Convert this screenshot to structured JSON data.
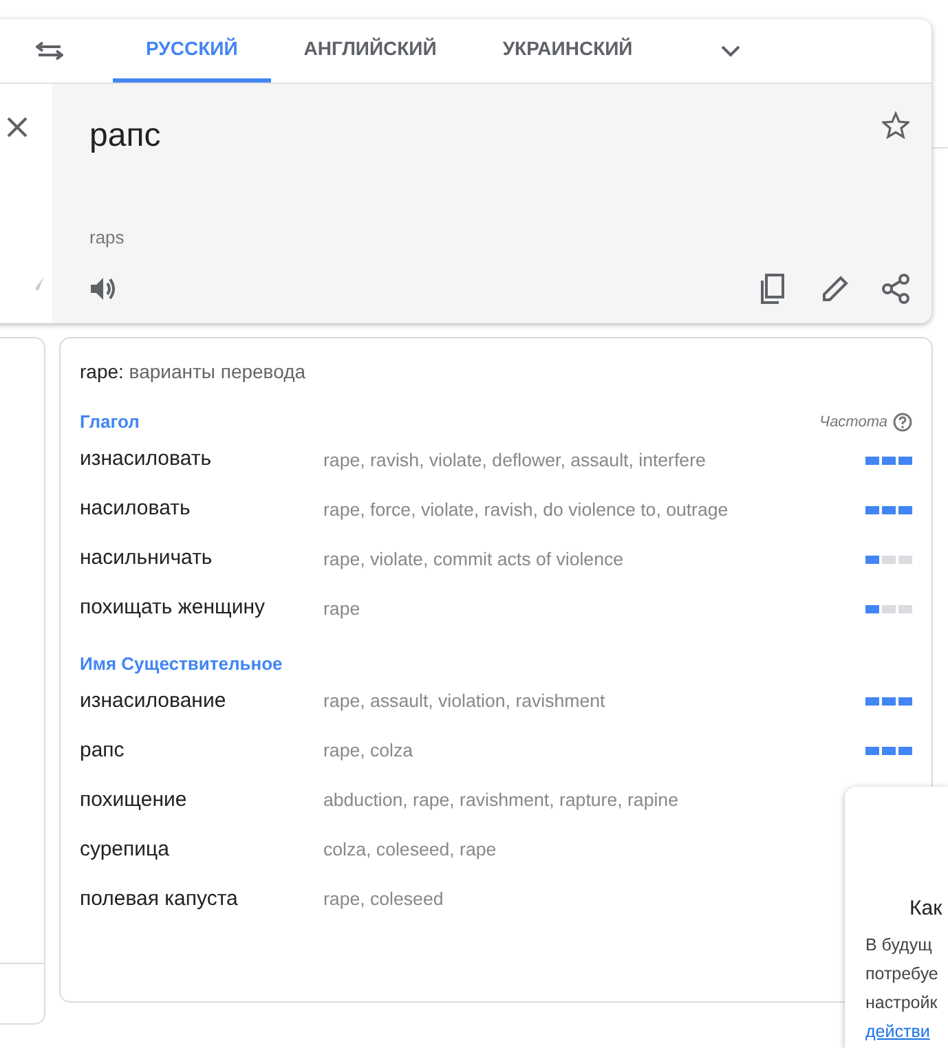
{
  "language_tabs": [
    {
      "label": "РУССКИЙ",
      "selected": true
    },
    {
      "label": "АНГЛИЙСКИЙ",
      "selected": false
    },
    {
      "label": "УКРАИНСКИЙ",
      "selected": false
    }
  ],
  "translation": {
    "text": "рапс",
    "transliteration": "raps"
  },
  "dictionary": {
    "title": "**rape:** варианты перевода",
    "frequency_label": "Частота",
    "groups": [
      {
        "part_of_speech": "Глагол",
        "entries": [
          {
            "word": "изнасиловать",
            "synonyms": "rape, ravish, violate, deflower, assault, interfere",
            "level": 1
          },
          {
            "word": "насиловать",
            "synonyms": "rape, force, violate, ravish, do violence to, outrage",
            "level": 1
          },
          {
            "word": "насильничать",
            "synonyms": "rape, violate, commit acts of violence",
            "level": 0.33
          },
          {
            "word": "похищать женщину",
            "synonyms": "rape",
            "level": 0.33
          }
        ]
      },
      {
        "part_of_speech": "Имя Существительное",
        "entries": [
          {
            "word": "изнасилование",
            "synonyms": "rape, assault, violation, ravishment",
            "level": 1
          },
          {
            "word": "рапс",
            "synonyms": "rape, colza",
            "level": 1
          },
          {
            "word": "похищение",
            "synonyms": "abduction, rape, ravishment, rapture, rapine"
          },
          {
            "word": "сурепица",
            "synonyms": "colza, coleseed, rape"
          },
          {
            "word": "полевая капуста",
            "synonyms": "rape, coleseed"
          }
        ]
      }
    ]
  },
  "popup": {
    "title": "Как",
    "lines": [
      "В будущ",
      "потребуе",
      "настройк"
    ],
    "link": "действи"
  }
}
